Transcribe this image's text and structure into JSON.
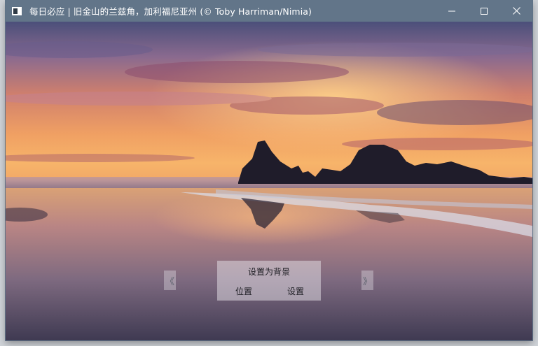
{
  "window": {
    "title": "每日必应 | 旧金山的兰兹角，加利福尼亚州 (© Toby Harriman/Nimia)",
    "icon": "app-window-icon",
    "controls": {
      "minimize_icon": "minimize-icon",
      "maximize_icon": "maximize-icon",
      "close_icon": "close-icon"
    }
  },
  "wallpaper": {
    "description_icon": "sunset-beach-photo"
  },
  "navigation": {
    "prev_label": "《",
    "next_label": "》"
  },
  "actions": {
    "set_background_label": "设置为背景",
    "location_label": "位置",
    "settings_label": "设置"
  },
  "colors": {
    "titlebar": "#627589",
    "panel": "#e8e4ea"
  }
}
